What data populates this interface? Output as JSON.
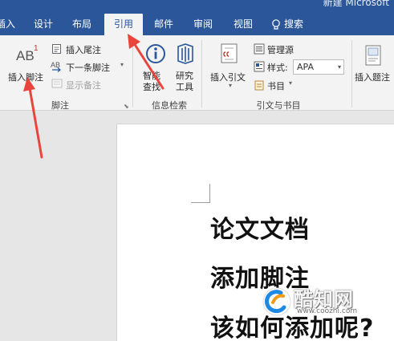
{
  "window": {
    "title": "新建 Microsoft"
  },
  "tabs": [
    {
      "label": "插入"
    },
    {
      "label": "设计"
    },
    {
      "label": "布局"
    },
    {
      "label": "引用",
      "active": true
    },
    {
      "label": "邮件"
    },
    {
      "label": "审阅"
    },
    {
      "label": "视图"
    },
    {
      "label": "搜索",
      "icon": "lightbulb-icon"
    }
  ],
  "ribbon": {
    "footnotes": {
      "group_label": "脚注",
      "insert_footnote": "插入脚注",
      "insert_endnote": "插入尾注",
      "next_footnote": "下一条脚注",
      "show_notes": "显示备注",
      "icon_text": "AB",
      "icon_sup": "1",
      "endnote_icon_text": "AB"
    },
    "research": {
      "group_label": "信息检索",
      "smart_lookup": [
        "智能",
        "查找"
      ],
      "researcher": [
        "研究",
        "工具"
      ]
    },
    "citations": {
      "group_label": "引文与书目",
      "insert_citation": "插入引文",
      "manage_sources": "管理源",
      "style_label": "样式:",
      "style_value": "APA",
      "bibliography": "书目"
    },
    "captions": {
      "insert_caption": "插入题注"
    }
  },
  "document": {
    "lines": [
      "论文文档",
      "添加脚注",
      "该如何添加呢?"
    ]
  },
  "watermark": {
    "name": "酷知网",
    "url": "www.coozhi.com"
  },
  "colors": {
    "tabbar": "#2b579a",
    "ribbon": "#f3f3f3",
    "arrow": "#e8453c"
  }
}
